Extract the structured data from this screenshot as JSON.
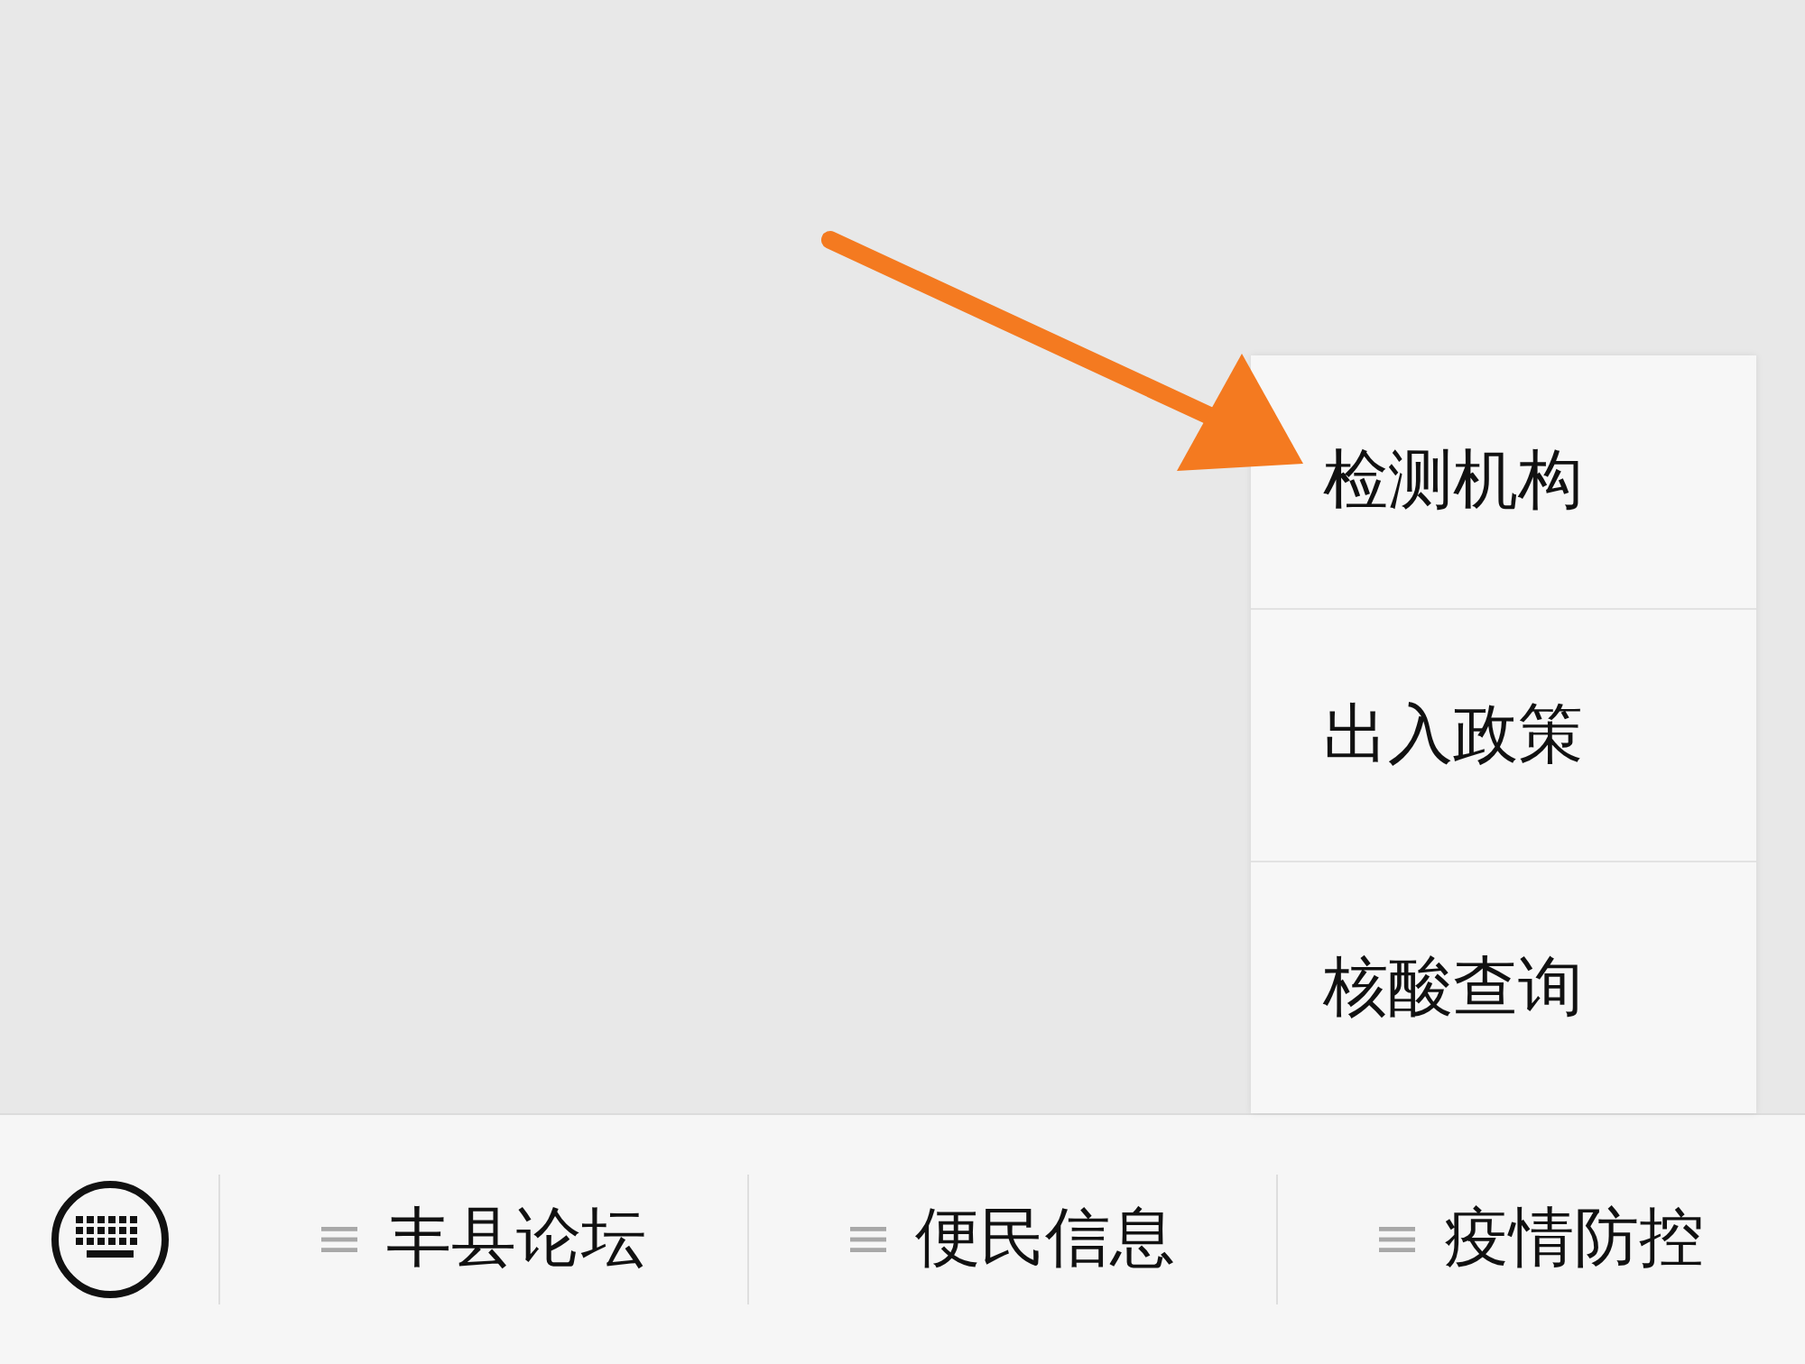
{
  "bottom_bar": {
    "menus": [
      {
        "label": "丰县论坛"
      },
      {
        "label": "便民信息"
      },
      {
        "label": "疫情防控",
        "submenu": [
          {
            "label": "检测机构"
          },
          {
            "label": "出入政策"
          },
          {
            "label": "核酸查询"
          }
        ]
      }
    ]
  }
}
